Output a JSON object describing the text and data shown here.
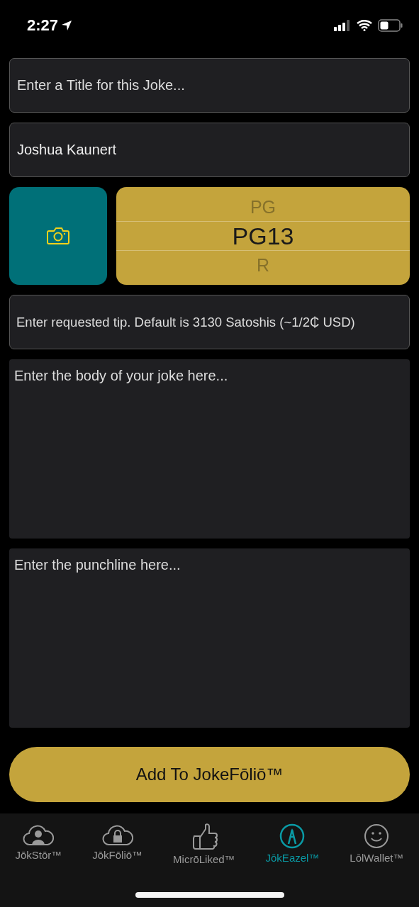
{
  "status_bar": {
    "time": "2:27"
  },
  "form": {
    "title_field": {
      "placeholder": "Enter a Title for this Joke..."
    },
    "author_field": {
      "value": "Joshua Kaunert"
    },
    "rating_picker": {
      "options": [
        {
          "label": "PG",
          "selected": false
        },
        {
          "label": "PG13",
          "selected": true
        },
        {
          "label": "R",
          "selected": false
        }
      ]
    },
    "tip_field": {
      "placeholder": "Enter requested tip. Default is 3130 Satoshis (~1/2₵ USD)"
    },
    "body_field": {
      "placeholder": "Enter the body of your joke here..."
    },
    "punchline_field": {
      "placeholder": "Enter the punchline here..."
    },
    "submit_button": "Add To JokeFōliō™"
  },
  "tab_bar": [
    {
      "kind": "cloud-person",
      "label": "JōkStōr™",
      "selected": false
    },
    {
      "kind": "cloud-lock",
      "label": "JōkFōliō™",
      "selected": false
    },
    {
      "kind": "thumb",
      "label": "MicrōLiked™",
      "selected": false
    },
    {
      "kind": "pen",
      "label": "JōkEazel™",
      "selected": true
    },
    {
      "kind": "smile",
      "label": "LōlWallet™",
      "selected": false
    }
  ]
}
